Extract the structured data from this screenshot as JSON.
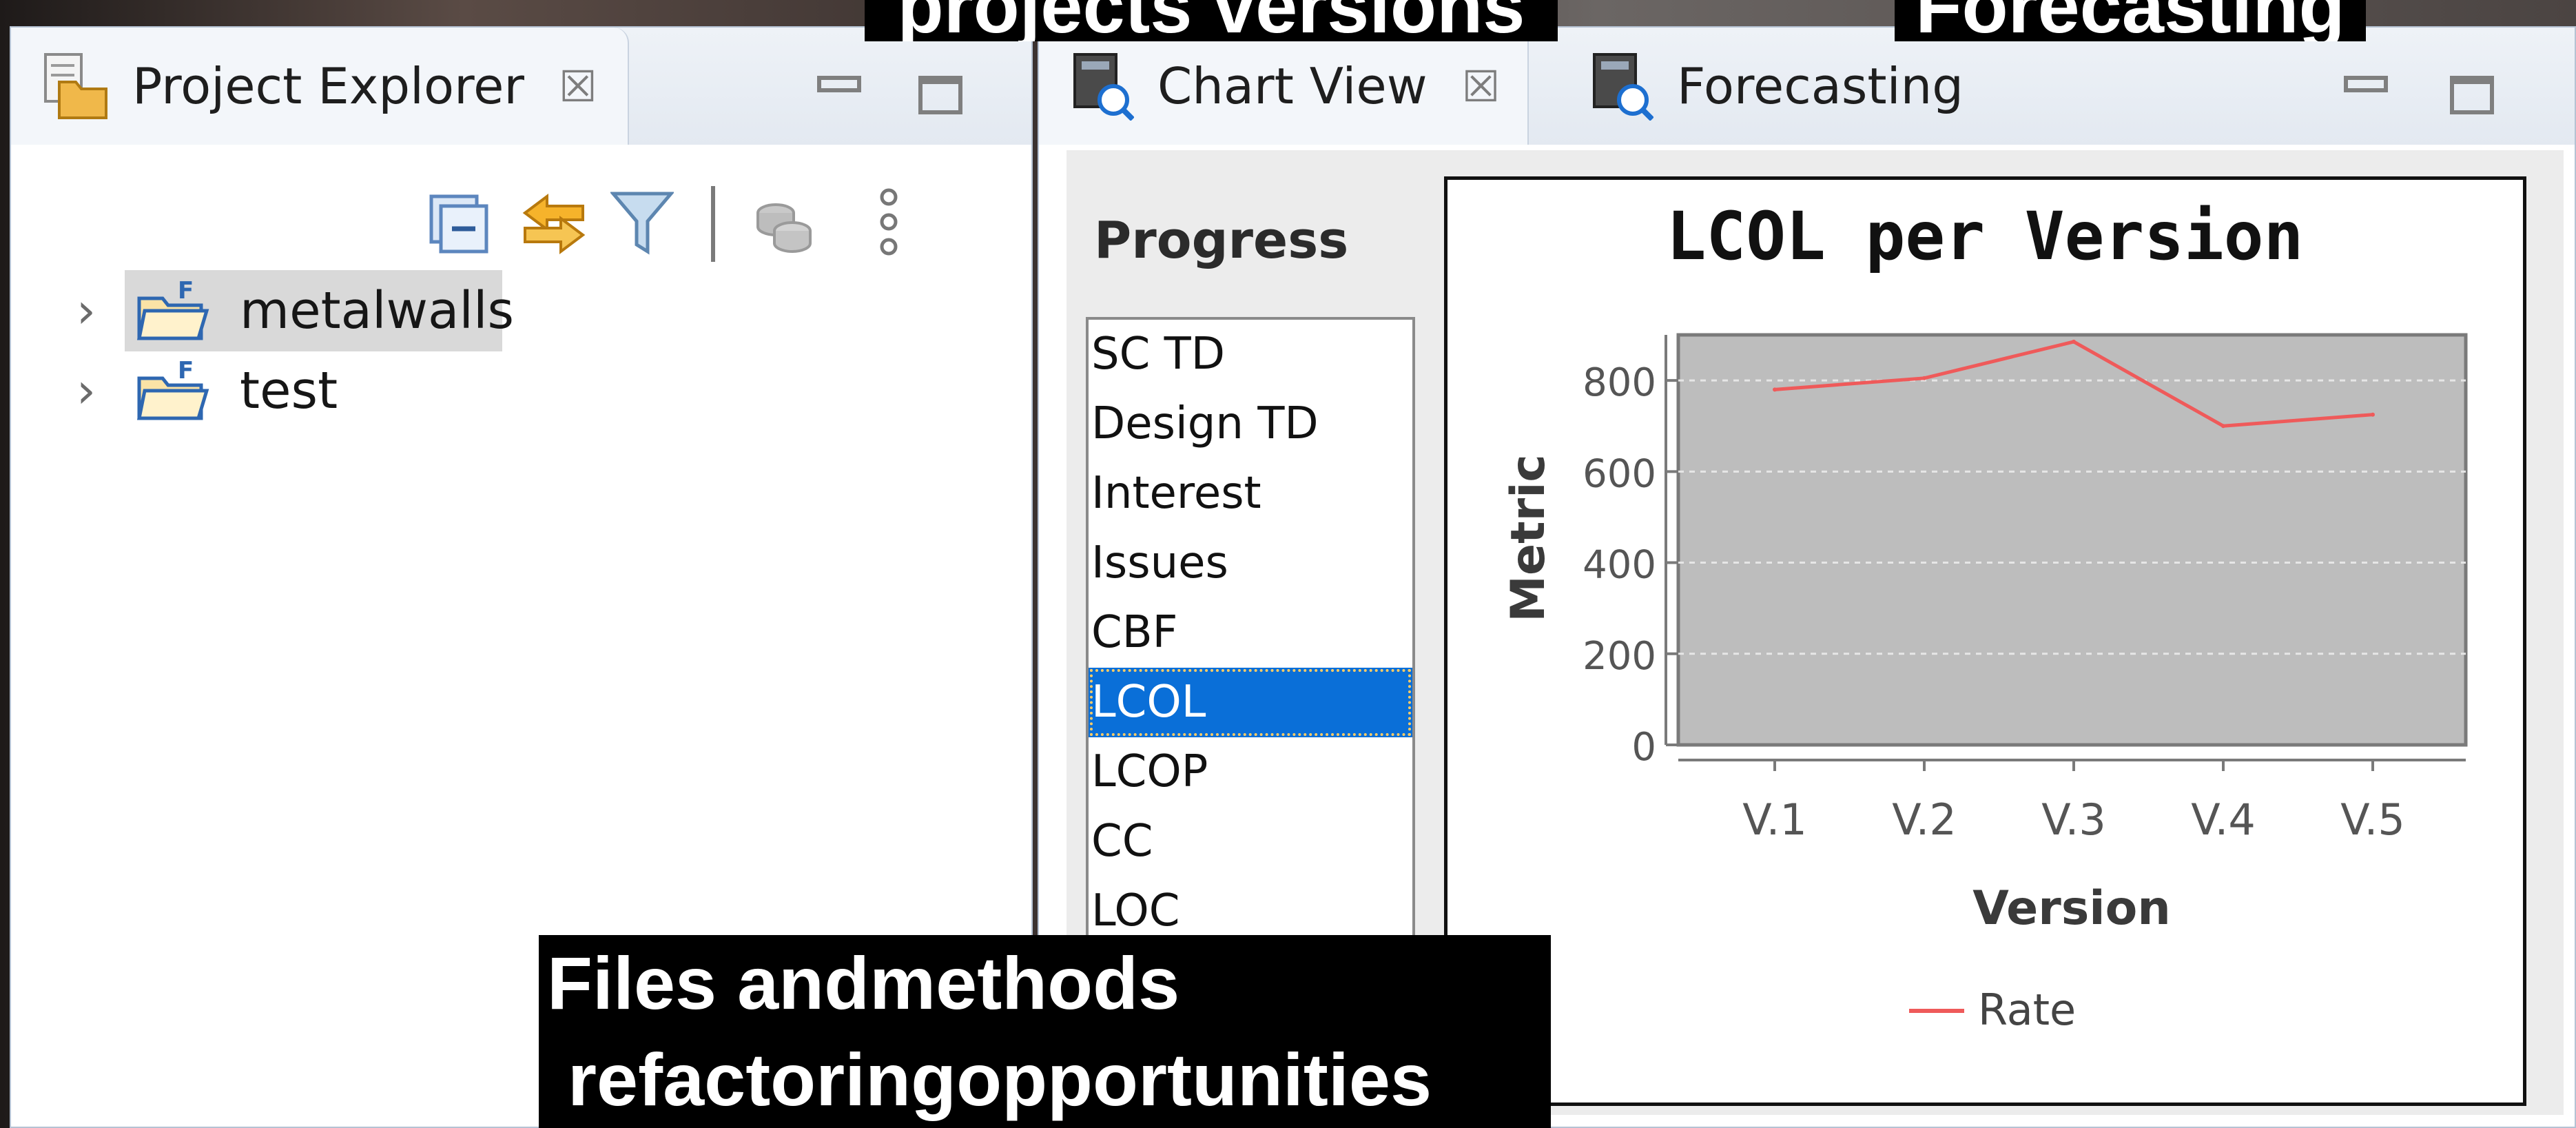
{
  "overlays": {
    "top_left": "projects versions",
    "top_right": "Forecasting",
    "bottom_line1": "Files andmethods",
    "bottom_line2": " refactoringopportunities"
  },
  "explorer": {
    "tab_label": "Project Explorer",
    "tree": [
      {
        "label": "metalwalls",
        "selected": true
      },
      {
        "label": "test",
        "selected": false
      }
    ]
  },
  "chart_view": {
    "tabs": [
      {
        "label": "Chart View",
        "active": true
      },
      {
        "label": "Forecasting",
        "active": false
      }
    ],
    "progress_label": "Progress",
    "metrics": [
      "SC TD",
      "Design TD",
      "Interest",
      "Issues",
      "CBF",
      "LCOL",
      "LCOP",
      "CC",
      "LOC"
    ],
    "selected_metric": "LCOL"
  },
  "colors": {
    "selection_blue": "#0a6fd8",
    "series_red": "#ef5a5a",
    "plot_bg": "#bdbdbd"
  },
  "chart_data": {
    "type": "line",
    "title": "LCOL per Version",
    "xlabel": "Version",
    "ylabel": "Metric",
    "categories": [
      "V.1",
      "V.2",
      "V.3",
      "V.4",
      "V.5"
    ],
    "series": [
      {
        "name": "Rate",
        "values": [
          780,
          805,
          885,
          700,
          725
        ]
      }
    ],
    "ylim": [
      0,
      900
    ],
    "yticks": [
      0,
      200,
      400,
      600,
      800
    ],
    "grid": true,
    "legend": "bottom"
  }
}
